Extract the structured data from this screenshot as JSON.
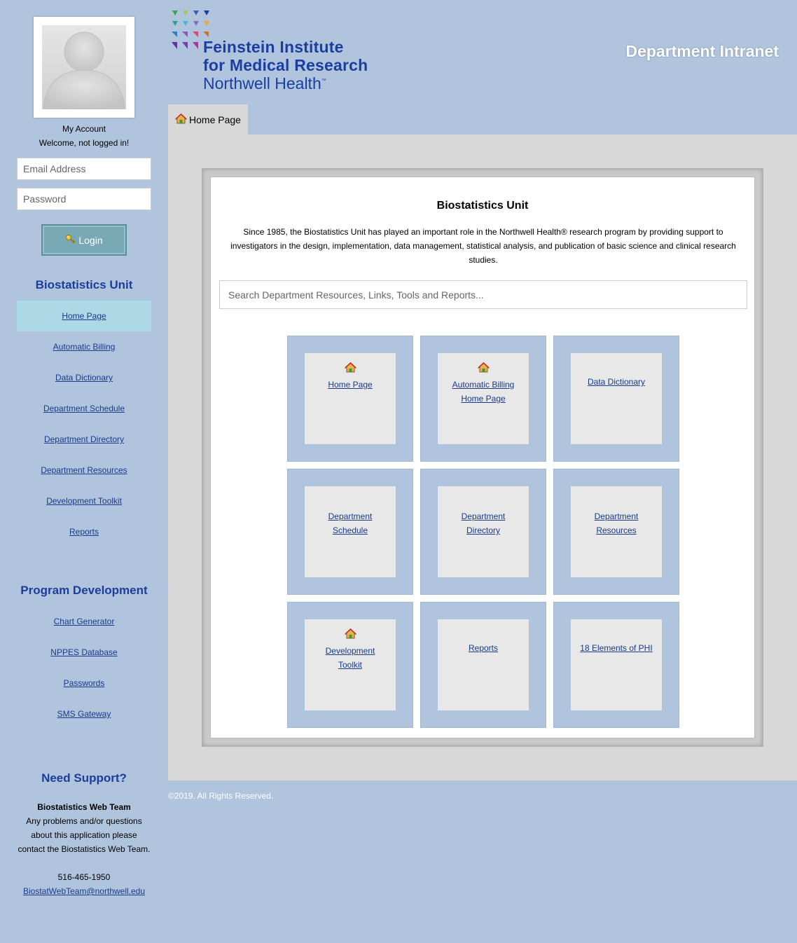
{
  "sidebar": {
    "account_label": "My Account",
    "welcome_text": "Welcome, not logged in!",
    "email_placeholder": "Email Address",
    "password_placeholder": "Password",
    "login_label": "Login",
    "unit_heading": "Biostatistics Unit",
    "unit_items": [
      {
        "label": "Home Page",
        "active": true
      },
      {
        "label": "Automatic Billing"
      },
      {
        "label": "Data Dictionary"
      },
      {
        "label": "Department Schedule"
      },
      {
        "label": "Department Directory"
      },
      {
        "label": "Department Resources"
      },
      {
        "label": "Development Toolkit"
      },
      {
        "label": "Reports"
      }
    ],
    "program_heading": "Program Development",
    "program_items": [
      {
        "label": "Chart Generator"
      },
      {
        "label": "NPPES Database"
      },
      {
        "label": "Passwords"
      },
      {
        "label": "SMS Gateway"
      }
    ],
    "support": {
      "heading": "Need Support?",
      "team": "Biostatistics Web Team",
      "line1": "Any problems and/or questions",
      "line2": "about this application please",
      "line3": "contact the Biostatistics Web Team.",
      "phone": "516-465-1950",
      "email": "BiostatWebTeam@northwell.edu"
    }
  },
  "header": {
    "logo_line1": "Feinstein Institute",
    "logo_line2": "for Medical Research",
    "logo_line3": "Northwell Health",
    "logo_tm": "™",
    "site_title": "Department Intranet"
  },
  "tab": {
    "label": "Home Page",
    "icon": "home-icon"
  },
  "main": {
    "title": "Biostatistics Unit",
    "description": "Since 1985, the Biostatistics Unit has played an important role in the Northwell Health® research program by providing support to investigators in the design, implementation, data management, statistical analysis, and publication of basic science and clinical research studies.",
    "search_placeholder": "Search Department Resources, Links, Tools and Reports...",
    "tiles": [
      {
        "label": "Home Page",
        "icon": "home-icon"
      },
      {
        "label": "Automatic Billing Home Page",
        "icon": "home-icon"
      },
      {
        "label": "Data Dictionary",
        "icon": ""
      },
      {
        "label": "Department Schedule",
        "icon": ""
      },
      {
        "label": "Department Directory",
        "icon": ""
      },
      {
        "label": "Department Resources",
        "icon": ""
      },
      {
        "label": "Development Toolkit",
        "icon": "home-icon"
      },
      {
        "label": "Reports",
        "icon": ""
      },
      {
        "label": "18 Elements of PHI",
        "icon": ""
      }
    ]
  },
  "footer": {
    "copyright": "©2019. All Rights Reserved."
  },
  "colors": {
    "page_bg": "#b0c4de",
    "content_bg": "#d8d8d8",
    "heading_blue": "#1a3e9a",
    "link_blue": "#1a3a8a",
    "active_item": "#add8e6",
    "login_button": "#78a9b4"
  }
}
